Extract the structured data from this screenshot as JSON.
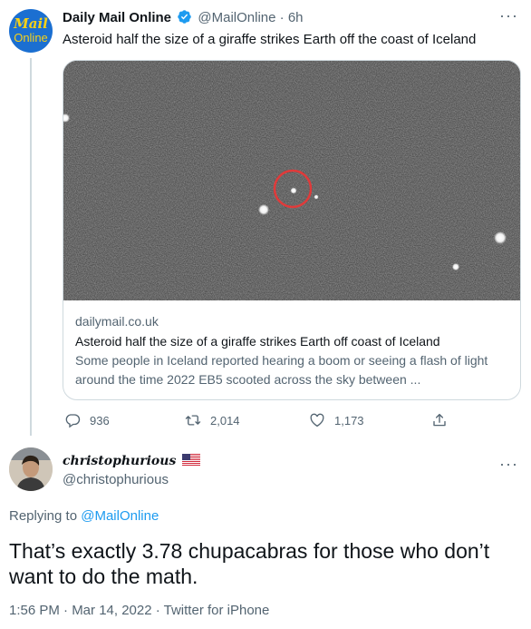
{
  "tweet": {
    "author_name": "Daily Mail Online",
    "author_handle": "@MailOnline",
    "separator": "·",
    "time": "6h",
    "text": "Asteroid half the size of a giraffe strikes Earth off the coast of Iceland",
    "avatar": {
      "line1": "Mail",
      "line2": "Online"
    },
    "more": "···",
    "card": {
      "domain": "dailymail.co.uk",
      "title": "Asteroid half the size of a giraffe strikes Earth off coast of Iceland",
      "description": "Some people in Iceland reported hearing a boom or seeing a flash of light around the time 2022 EB5 scooted across the sky between ..."
    },
    "actions": {
      "replies": "936",
      "retweets": "2,014",
      "likes": "1,173"
    }
  },
  "reply": {
    "author_name": "christophurious",
    "author_handle": "@christophurious",
    "more": "···",
    "replying_prefix": "Replying to",
    "replying_mention": "@MailOnline",
    "text": "That’s exactly 3.78 chupacabras for those who don’t want to do the math.",
    "meta": "1:56 PM · Mar 14, 2022 · Twitter for iPhone"
  },
  "colors": {
    "accent": "#1d9bf0",
    "secondary_text": "#536471",
    "border": "#cfd9de",
    "mail_blue": "#1b6fd1",
    "mail_yellow": "#f7d117"
  }
}
